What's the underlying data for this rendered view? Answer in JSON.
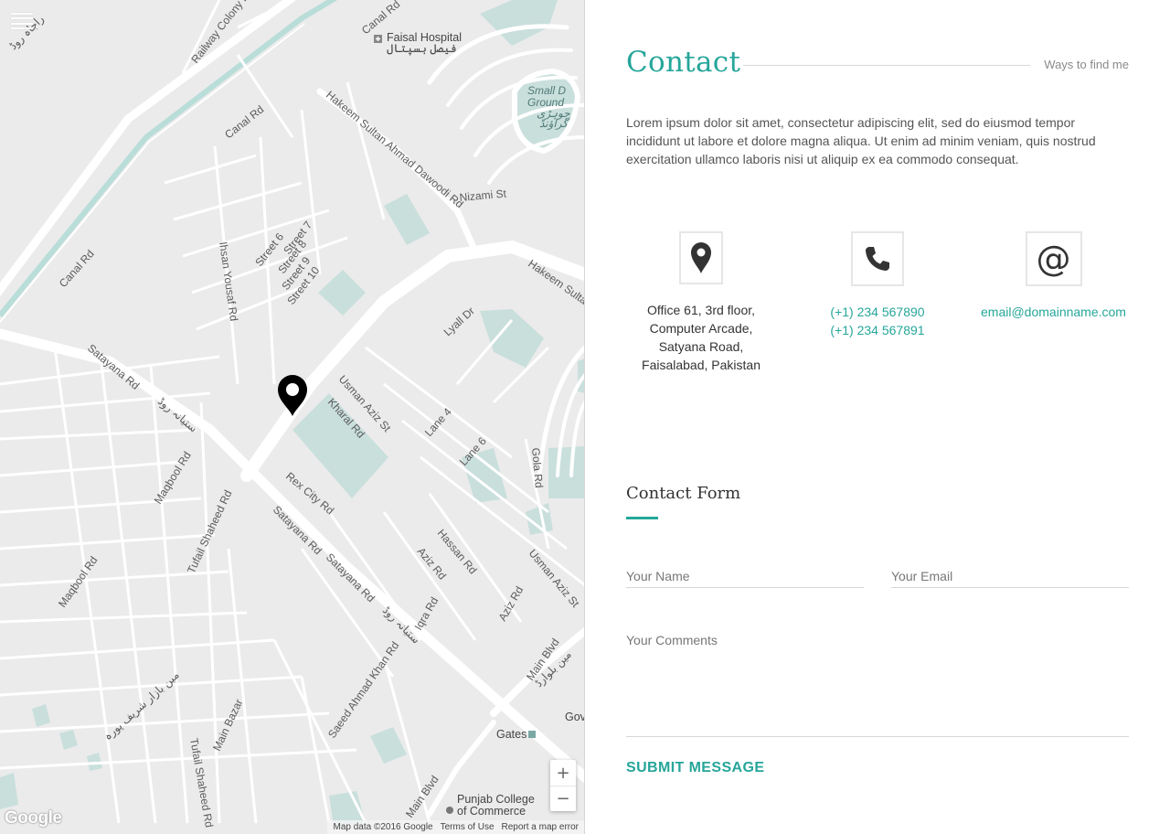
{
  "map": {
    "streets": [
      "Canal Rd",
      "Canal Rd",
      "Canal Rd",
      "Railway Colony Rd",
      "Hakeem Sultan Ahmad Dawoodi Rd",
      "Nizami St",
      "Hakeem Sulta",
      "Ihsan Yousaf Rd",
      "Street 6",
      "Street 7",
      "Street 8",
      "Street 9",
      "Street 10",
      "Lyall Dr",
      "Satayana Rd",
      "Usman Aziz St",
      "Kharal Rd",
      "Lane 4",
      "Lane 6",
      "Gola Rd",
      "Maqbool Rd",
      "Rex City Rd",
      "Tufail Shaheed Rd",
      "Satayana Rd",
      "Satayana Rd",
      "Hassan Rd",
      "Aziz Rd",
      "Usman Aziz St",
      "Maqbool Rd",
      "Iqra Rd",
      "Aziz Rd",
      "Main Blvd",
      "Saeed Ahmad Khan Rd",
      "Main Bazar",
      "Tufail Shaheed Rd",
      "Main Blvd"
    ],
    "urdu_labels": [
      "ستیانہ روڈ",
      "ستیانہ روڈ",
      "مین بازار شریف پورہ",
      "مین بلوارڈ",
      "راجاہ روڈ"
    ],
    "pois": [
      "Faisal Hospital",
      "فیصل ہسپتال",
      "Small D",
      "Ground",
      "جوہڑی",
      "گراؤنڈ",
      "Punjab College",
      "of Commerce",
      "Gates",
      "Gov"
    ],
    "logo": "Google",
    "attribution": "Map data ©2016 Google",
    "terms": "Terms of Use",
    "report": "Report a map error",
    "zoom_in": "+",
    "zoom_out": "−",
    "icons": {
      "menu": "hamburger-icon",
      "pin": "map-pin-icon"
    }
  },
  "header": {
    "title": "Contact",
    "subtitle": "Ways to find me"
  },
  "intro": "Lorem ipsum dolor sit amet, consectetur adipiscing elit, sed do eiusmod tempor incididunt ut labore et dolore magna aliqua. Ut enim ad minim veniam, quis nostrud exercitation ullamco laboris nisi ut aliquip ex ea commodo consequat.",
  "info": {
    "address": {
      "icon": "location-pin-icon",
      "lines": [
        "Office 61, 3rd floor,",
        "Computer Arcade,",
        "Satyana Road,",
        "Faisalabad, Pakistan"
      ]
    },
    "phone": {
      "icon": "phone-icon",
      "lines": [
        "(+1) 234 567890",
        "(+1) 234 567891"
      ]
    },
    "email": {
      "icon": "at-sign-icon",
      "glyph": "@",
      "lines": [
        "email@domainname.com"
      ]
    }
  },
  "form": {
    "title": "Contact Form",
    "name_placeholder": "Your Name",
    "email_placeholder": "Your Email",
    "comments_placeholder": "Your Comments",
    "submit_label": "SUBMIT MESSAGE"
  },
  "colors": {
    "accent": "#26a69a",
    "map_bg": "#ebebeb",
    "map_road": "#ffffff",
    "map_canal": "#b9ddd9"
  }
}
